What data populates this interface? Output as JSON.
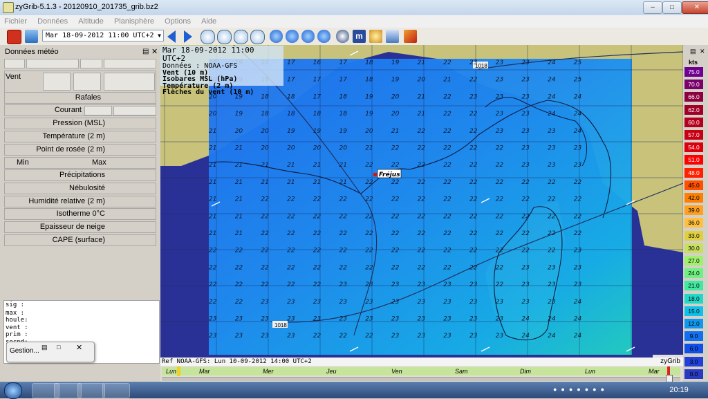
{
  "window": {
    "title": "zyGrib-5.1.3 - 20120910_201735_grib.bz2"
  },
  "menu": [
    "Fichier",
    "Données",
    "Altitude",
    "Planisphère",
    "Options",
    "Aide"
  ],
  "toolbar": {
    "date_value": "Mar 18-09-2012 11:00 UTC+2"
  },
  "left_panel": {
    "title": "Données météo",
    "vent": "Vent",
    "rafales": "Rafales",
    "courant": "Courant",
    "pression": "Pression (MSL)",
    "temperature": "Température (2 m)",
    "rosee": "Point de rosée (2 m)",
    "min": "Min",
    "max": "Max",
    "precip": "Précipitations",
    "nebulosite": "Nébulosité",
    "humidite": "Humidité relative (2 m)",
    "isotherme": "Isotherme 0°C",
    "neige": "Epaisseur de neige",
    "cape": "CAPE (surface)"
  },
  "log_lines": [
    "sig  :",
    "max  :",
    "houle:",
    "vent :",
    "prim :",
    "secnd:"
  ],
  "gestion": "Gestion...",
  "info_box": {
    "line1": "Mar 18-09-2012 11:00 UTC+2",
    "line2": "Données : NOAA-GFS",
    "line3": "Vent (10 m)",
    "line4": "Isobares MSL (hPa)",
    "line5": "Température (2 m)",
    "line6": "Flèches du vent (10 m)"
  },
  "map": {
    "city": "Fréjus",
    "isobar_top": "1018",
    "isobar_bottom": "1018",
    "brand": "zyGrib",
    "rows": [
      [
        19,
        19,
        18,
        17,
        16,
        17,
        18,
        19,
        21,
        22,
        23,
        23,
        23,
        24,
        25
      ],
      [
        20,
        19,
        18,
        17,
        17,
        17,
        18,
        19,
        20,
        21,
        22,
        23,
        23,
        24,
        25
      ],
      [
        20,
        19,
        18,
        18,
        17,
        18,
        19,
        20,
        21,
        22,
        23,
        23,
        23,
        24,
        24
      ],
      [
        20,
        19,
        18,
        18,
        18,
        18,
        19,
        20,
        21,
        22,
        22,
        23,
        23,
        24,
        24
      ],
      [
        21,
        20,
        20,
        19,
        19,
        19,
        20,
        21,
        22,
        22,
        22,
        23,
        23,
        23,
        24
      ],
      [
        21,
        21,
        20,
        20,
        20,
        20,
        21,
        22,
        22,
        22,
        22,
        22,
        23,
        23,
        23
      ],
      [
        21,
        21,
        21,
        21,
        21,
        21,
        22,
        22,
        22,
        22,
        22,
        22,
        23,
        23,
        23
      ],
      [
        21,
        21,
        21,
        21,
        21,
        21,
        22,
        22,
        22,
        22,
        22,
        22,
        22,
        22,
        22
      ],
      [
        21,
        21,
        22,
        22,
        22,
        22,
        22,
        22,
        22,
        22,
        22,
        22,
        22,
        22,
        22
      ],
      [
        21,
        21,
        22,
        22,
        22,
        22,
        22,
        22,
        22,
        22,
        22,
        22,
        22,
        22,
        22
      ],
      [
        21,
        21,
        22,
        22,
        22,
        22,
        22,
        22,
        22,
        22,
        22,
        22,
        22,
        22,
        22
      ],
      [
        22,
        22,
        22,
        22,
        22,
        22,
        22,
        22,
        22,
        22,
        22,
        22,
        22,
        22,
        23
      ],
      [
        22,
        22,
        22,
        22,
        22,
        22,
        22,
        22,
        22,
        22,
        22,
        22,
        23,
        23,
        23
      ],
      [
        22,
        22,
        22,
        22,
        22,
        23,
        23,
        23,
        23,
        23,
        23,
        22,
        23,
        23,
        23
      ],
      [
        22,
        22,
        23,
        23,
        23,
        23,
        23,
        23,
        23,
        23,
        23,
        23,
        23,
        23,
        24
      ],
      [
        23,
        23,
        23,
        23,
        23,
        23,
        23,
        23,
        23,
        23,
        23,
        23,
        24,
        24,
        24
      ],
      [
        23,
        23,
        23,
        23,
        22,
        22,
        22,
        23,
        23,
        23,
        23,
        23,
        24,
        24,
        24
      ]
    ]
  },
  "scale": {
    "unit": "kts",
    "values": [
      "75.0",
      "70.0",
      "66.0",
      "62.0",
      "60.0",
      "57.0",
      "54.0",
      "51.0",
      "48.0",
      "45.0",
      "42.0",
      "39.0",
      "36.0",
      "33.0",
      "30.0",
      "27.0",
      "24.0",
      "21.0",
      "18.0",
      "15.0",
      "12.0",
      "9.0",
      "6.0",
      "3.0",
      "0.0"
    ],
    "colors": [
      "#6e0090",
      "#7a006a",
      "#8c0040",
      "#a00028",
      "#b4001c",
      "#c80014",
      "#dc000c",
      "#ff0000",
      "#ff2000",
      "#ff5000",
      "#ff8000",
      "#ffa020",
      "#ffc040",
      "#e0d040",
      "#c8e060",
      "#a0f070",
      "#70f080",
      "#40e8a0",
      "#20d8c8",
      "#10c0e8",
      "#1098f0",
      "#1070f0",
      "#1050e8",
      "#2040d8",
      "#283ac0"
    ]
  },
  "ref_bar": {
    "text": "Ref NOAA-GFS: Lun 10-09-2012 14:00 UTC+2",
    "brand": "zyGrib"
  },
  "timeline": [
    "Lun",
    "Mar",
    "Mer",
    "Jeu",
    "Ven",
    "Sam",
    "Dim",
    "Lun",
    "Mar"
  ],
  "taskbar": {
    "clock": "20:19"
  }
}
